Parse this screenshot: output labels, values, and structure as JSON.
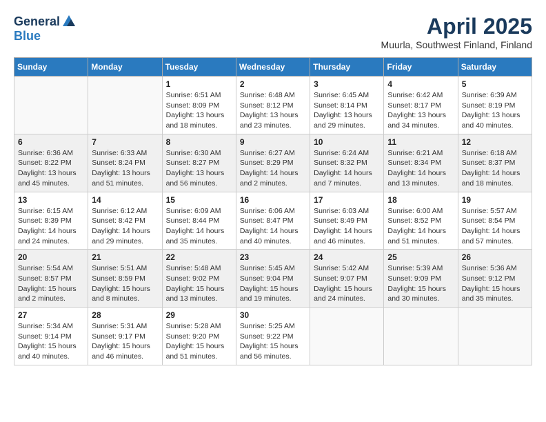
{
  "header": {
    "logo_general": "General",
    "logo_blue": "Blue",
    "month_title": "April 2025",
    "location": "Muurla, Southwest Finland, Finland"
  },
  "weekdays": [
    "Sunday",
    "Monday",
    "Tuesday",
    "Wednesday",
    "Thursday",
    "Friday",
    "Saturday"
  ],
  "weeks": [
    [
      {
        "day": "",
        "info": ""
      },
      {
        "day": "",
        "info": ""
      },
      {
        "day": "1",
        "info": "Sunrise: 6:51 AM\nSunset: 8:09 PM\nDaylight: 13 hours and 18 minutes."
      },
      {
        "day": "2",
        "info": "Sunrise: 6:48 AM\nSunset: 8:12 PM\nDaylight: 13 hours and 23 minutes."
      },
      {
        "day": "3",
        "info": "Sunrise: 6:45 AM\nSunset: 8:14 PM\nDaylight: 13 hours and 29 minutes."
      },
      {
        "day": "4",
        "info": "Sunrise: 6:42 AM\nSunset: 8:17 PM\nDaylight: 13 hours and 34 minutes."
      },
      {
        "day": "5",
        "info": "Sunrise: 6:39 AM\nSunset: 8:19 PM\nDaylight: 13 hours and 40 minutes."
      }
    ],
    [
      {
        "day": "6",
        "info": "Sunrise: 6:36 AM\nSunset: 8:22 PM\nDaylight: 13 hours and 45 minutes."
      },
      {
        "day": "7",
        "info": "Sunrise: 6:33 AM\nSunset: 8:24 PM\nDaylight: 13 hours and 51 minutes."
      },
      {
        "day": "8",
        "info": "Sunrise: 6:30 AM\nSunset: 8:27 PM\nDaylight: 13 hours and 56 minutes."
      },
      {
        "day": "9",
        "info": "Sunrise: 6:27 AM\nSunset: 8:29 PM\nDaylight: 14 hours and 2 minutes."
      },
      {
        "day": "10",
        "info": "Sunrise: 6:24 AM\nSunset: 8:32 PM\nDaylight: 14 hours and 7 minutes."
      },
      {
        "day": "11",
        "info": "Sunrise: 6:21 AM\nSunset: 8:34 PM\nDaylight: 14 hours and 13 minutes."
      },
      {
        "day": "12",
        "info": "Sunrise: 6:18 AM\nSunset: 8:37 PM\nDaylight: 14 hours and 18 minutes."
      }
    ],
    [
      {
        "day": "13",
        "info": "Sunrise: 6:15 AM\nSunset: 8:39 PM\nDaylight: 14 hours and 24 minutes."
      },
      {
        "day": "14",
        "info": "Sunrise: 6:12 AM\nSunset: 8:42 PM\nDaylight: 14 hours and 29 minutes."
      },
      {
        "day": "15",
        "info": "Sunrise: 6:09 AM\nSunset: 8:44 PM\nDaylight: 14 hours and 35 minutes."
      },
      {
        "day": "16",
        "info": "Sunrise: 6:06 AM\nSunset: 8:47 PM\nDaylight: 14 hours and 40 minutes."
      },
      {
        "day": "17",
        "info": "Sunrise: 6:03 AM\nSunset: 8:49 PM\nDaylight: 14 hours and 46 minutes."
      },
      {
        "day": "18",
        "info": "Sunrise: 6:00 AM\nSunset: 8:52 PM\nDaylight: 14 hours and 51 minutes."
      },
      {
        "day": "19",
        "info": "Sunrise: 5:57 AM\nSunset: 8:54 PM\nDaylight: 14 hours and 57 minutes."
      }
    ],
    [
      {
        "day": "20",
        "info": "Sunrise: 5:54 AM\nSunset: 8:57 PM\nDaylight: 15 hours and 2 minutes."
      },
      {
        "day": "21",
        "info": "Sunrise: 5:51 AM\nSunset: 8:59 PM\nDaylight: 15 hours and 8 minutes."
      },
      {
        "day": "22",
        "info": "Sunrise: 5:48 AM\nSunset: 9:02 PM\nDaylight: 15 hours and 13 minutes."
      },
      {
        "day": "23",
        "info": "Sunrise: 5:45 AM\nSunset: 9:04 PM\nDaylight: 15 hours and 19 minutes."
      },
      {
        "day": "24",
        "info": "Sunrise: 5:42 AM\nSunset: 9:07 PM\nDaylight: 15 hours and 24 minutes."
      },
      {
        "day": "25",
        "info": "Sunrise: 5:39 AM\nSunset: 9:09 PM\nDaylight: 15 hours and 30 minutes."
      },
      {
        "day": "26",
        "info": "Sunrise: 5:36 AM\nSunset: 9:12 PM\nDaylight: 15 hours and 35 minutes."
      }
    ],
    [
      {
        "day": "27",
        "info": "Sunrise: 5:34 AM\nSunset: 9:14 PM\nDaylight: 15 hours and 40 minutes."
      },
      {
        "day": "28",
        "info": "Sunrise: 5:31 AM\nSunset: 9:17 PM\nDaylight: 15 hours and 46 minutes."
      },
      {
        "day": "29",
        "info": "Sunrise: 5:28 AM\nSunset: 9:20 PM\nDaylight: 15 hours and 51 minutes."
      },
      {
        "day": "30",
        "info": "Sunrise: 5:25 AM\nSunset: 9:22 PM\nDaylight: 15 hours and 56 minutes."
      },
      {
        "day": "",
        "info": ""
      },
      {
        "day": "",
        "info": ""
      },
      {
        "day": "",
        "info": ""
      }
    ]
  ]
}
